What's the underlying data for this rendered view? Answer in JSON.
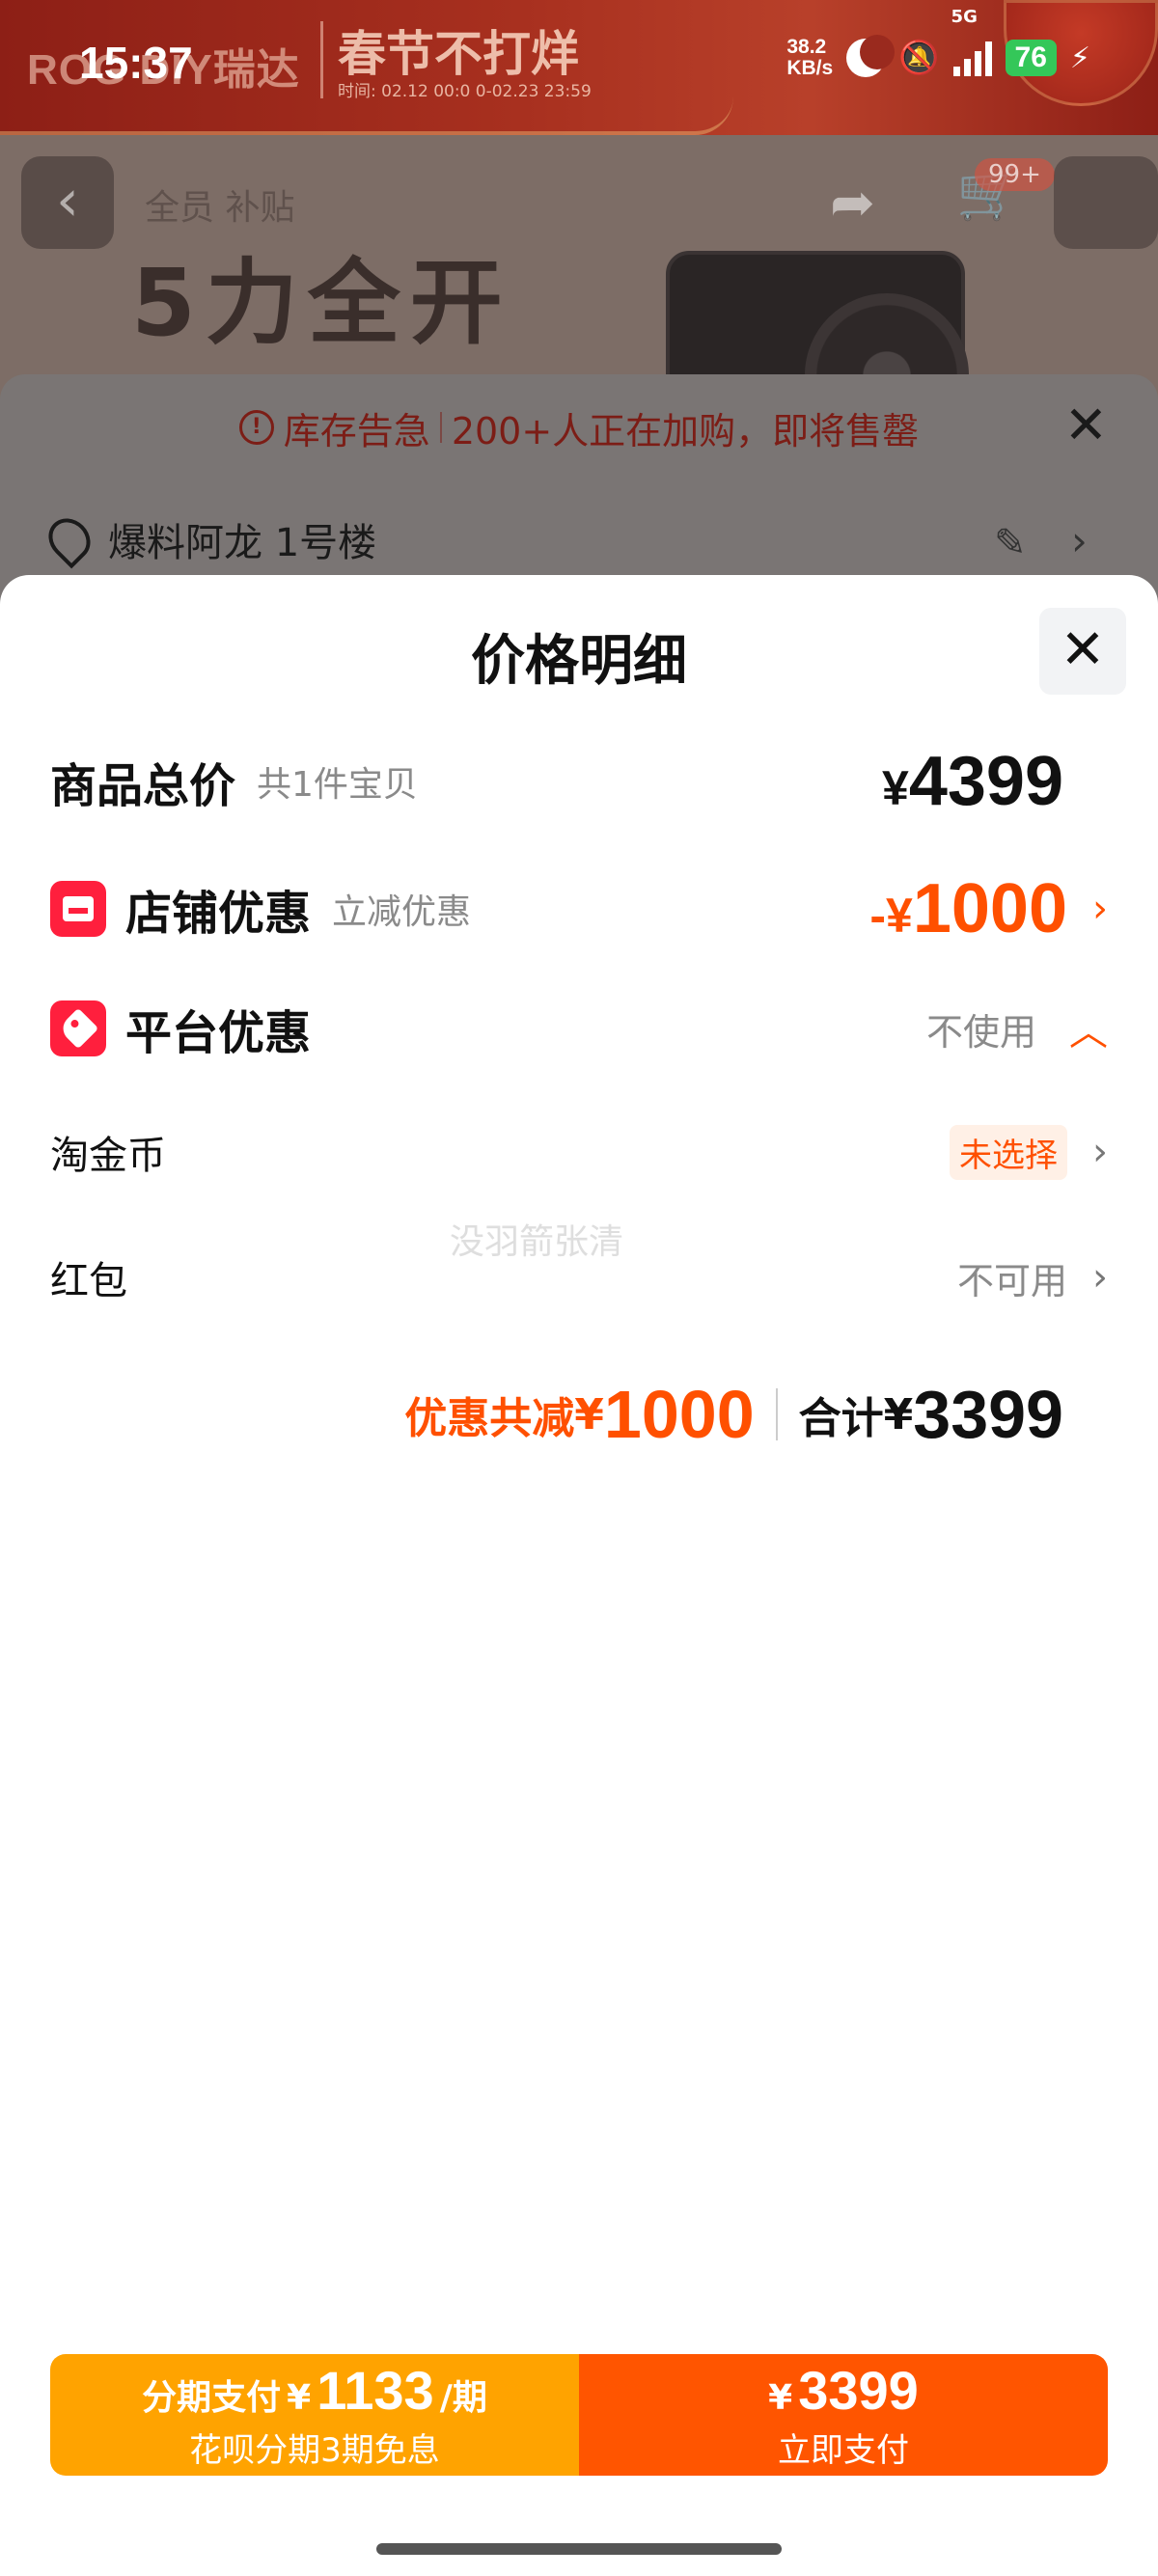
{
  "status_bar": {
    "time": "15:37",
    "net_speed_value": "38.2",
    "net_speed_unit": "KB/s",
    "network": "5G",
    "battery": "76"
  },
  "background": {
    "banner_brand": "ROG DIY瑞达",
    "banner_title": "春节不打烊",
    "banner_time": "时间: 02.12 00:0 0-02.23 23:59",
    "breadcrumb": "全员 补贴",
    "promo_text": "5力全开",
    "cart_badge": "99+",
    "stock_alert_label": "库存告急",
    "stock_alert_text": "200+人正在加购，即将售罄",
    "address": "爆料阿龙 1号楼"
  },
  "sheet": {
    "title": "价格明细",
    "goods_total": {
      "label": "商品总价",
      "sub": "共1件宝贝",
      "currency": "¥",
      "amount": "4399"
    },
    "store_discount": {
      "label": "店铺优惠",
      "sub": "立减优惠",
      "prefix": "-¥",
      "amount": "1000",
      "icon": "store-icon"
    },
    "platform_discount": {
      "label": "平台优惠",
      "value": "不使用",
      "icon": "tag-icon",
      "expanded": true
    },
    "taojinbi": {
      "label": "淘金币",
      "value": "未选择"
    },
    "red_packet": {
      "label": "红包",
      "value": "不可用"
    },
    "watermark": "没羽箭张清",
    "summary": {
      "discount_label": "优惠共减",
      "discount_currency": "¥",
      "discount_amount": "1000",
      "total_label": "合计",
      "total_currency": "¥",
      "total_amount": "3399"
    }
  },
  "pay_bar": {
    "installment": {
      "label": "分期支付",
      "currency": "¥",
      "amount": "1133",
      "unit": "/期",
      "note": "花呗分期3期免息"
    },
    "pay_now": {
      "currency": "¥",
      "amount": "3399",
      "label": "立即支付"
    }
  },
  "colors": {
    "accent_orange": "#ff5000",
    "installment_bg": "#ffa300",
    "pay_now_bg": "#ff5500",
    "badge_red": "#ff1f3d"
  }
}
